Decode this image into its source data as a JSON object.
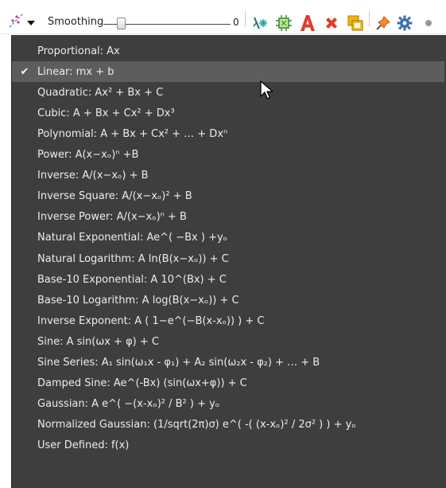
{
  "toolbar": {
    "smoothing": {
      "label": "Smoothing",
      "value": "0",
      "slider_fraction": 0.12
    },
    "icons": [
      "fit-curve-icon",
      "sparkle-tool-icon",
      "frame-tool-icon",
      "text-a-icon",
      "delete-x-icon",
      "copy-layers-icon",
      "pin-icon",
      "gear-icon"
    ],
    "colors": {
      "teal": "#2aa6a2",
      "red": "#e23a2a",
      "orange": "#f0a000",
      "blue": "#3a6fb0"
    }
  },
  "menu": {
    "selected_index": 1,
    "check_glyph": "✔",
    "items": [
      "Proportional: Ax",
      "Linear: mx + b",
      "Quadratic: Ax² + Bx + C",
      "Cubic: A + Bx + Cx² + Dx³",
      "Polynomial: A + Bx + Cx² + … + Dxⁿ",
      "Power: A(x−xₒ)ⁿ +B",
      "Inverse: A/(x−xₒ) + B",
      "Inverse Square: A/(x−xₒ)² + B",
      "Inverse Power: A/(x−xₒ)ⁿ + B",
      "Natural Exponential: Ae^( −Bx ) +yₒ",
      "Natural Logarithm: A ln(B(x−xₒ)) + C",
      "Base-10 Exponential: A 10^(Bx) + C",
      "Base-10 Logarithm: A log(B(x−xₒ)) + C",
      "Inverse Exponent: A ( 1−e^(−B(x-xₒ)) ) + C",
      "Sine: A sin(ωx + φ) + C",
      "Sine Series: A₁ sin(ω₁x - φ₁) + A₂ sin(ω₂x - φ₂) + … + B",
      "Damped Sine: Ae^(-Bx) (sin(ωx+φ)) + C",
      "Gaussian:  A e^( −(x-xₒ)² / B²  ) + yₒ",
      "Normalized Gaussian: (1/sqrt(2π)σ) e^( -( (x-xₒ)² / 2σ² ) ) + yₒ",
      "User Defined: f(x)"
    ]
  }
}
